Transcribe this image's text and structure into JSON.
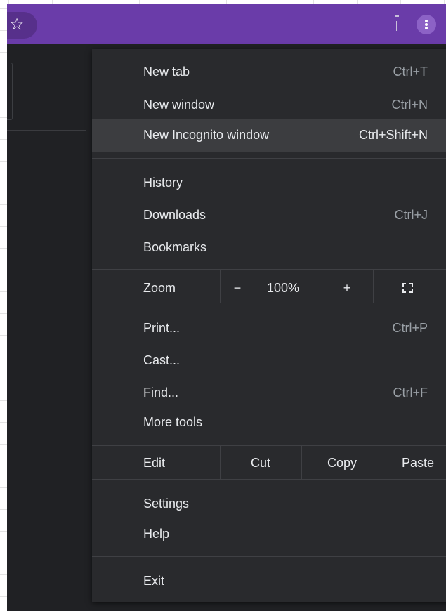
{
  "toolbar": {
    "accent_color": "#6a3ca9",
    "star_glyph": "☆",
    "star_icon": "star-icon",
    "menu_icon": "three-dots-vertical-icon"
  },
  "menu": {
    "new_tab": {
      "label": "New tab",
      "shortcut": "Ctrl+T"
    },
    "new_window": {
      "label": "New window",
      "shortcut": "Ctrl+N"
    },
    "new_incognito": {
      "label": "New Incognito window",
      "shortcut": "Ctrl+Shift+N"
    },
    "history": {
      "label": "History"
    },
    "downloads": {
      "label": "Downloads",
      "shortcut": "Ctrl+J"
    },
    "bookmarks": {
      "label": "Bookmarks"
    },
    "zoom": {
      "label": "Zoom",
      "minus": "−",
      "level": "100%",
      "plus": "+"
    },
    "print": {
      "label": "Print...",
      "shortcut": "Ctrl+P"
    },
    "cast": {
      "label": "Cast..."
    },
    "find": {
      "label": "Find...",
      "shortcut": "Ctrl+F"
    },
    "more_tools": {
      "label": "More tools"
    },
    "edit": {
      "label": "Edit",
      "cut": "Cut",
      "copy": "Copy",
      "paste": "Paste"
    },
    "settings": {
      "label": "Settings"
    },
    "help": {
      "label": "Help"
    },
    "exit": {
      "label": "Exit"
    }
  }
}
